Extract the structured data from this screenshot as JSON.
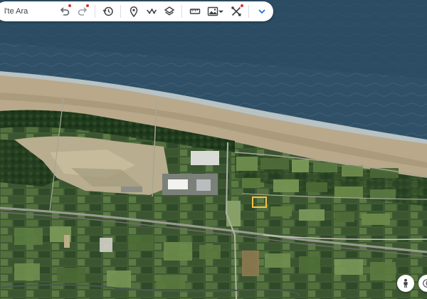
{
  "search": {
    "text": "l'te Ara"
  },
  "toolbar": {
    "buttons": [
      {
        "name": "undo-button",
        "icon": "undo-icon"
      },
      {
        "name": "redo-button",
        "icon": "redo-icon"
      },
      {
        "name": "history-button",
        "icon": "history-icon"
      },
      {
        "name": "placemark-button",
        "icon": "pin-icon"
      },
      {
        "name": "path-button",
        "icon": "path-icon"
      },
      {
        "name": "layers-button",
        "icon": "layers-icon"
      },
      {
        "name": "measure-button",
        "icon": "ruler-icon"
      },
      {
        "name": "image-button",
        "icon": "image-icon"
      },
      {
        "name": "tools-button",
        "icon": "tools-icon"
      },
      {
        "name": "expand-button",
        "icon": "chevron-down-icon"
      }
    ],
    "accent_color": "#1a73e8",
    "notification_color": "#d93025"
  },
  "controls": {
    "pegman": "pegman-icon",
    "compass": "compass-icon"
  },
  "map": {
    "highlight_color": "#f6c342"
  }
}
